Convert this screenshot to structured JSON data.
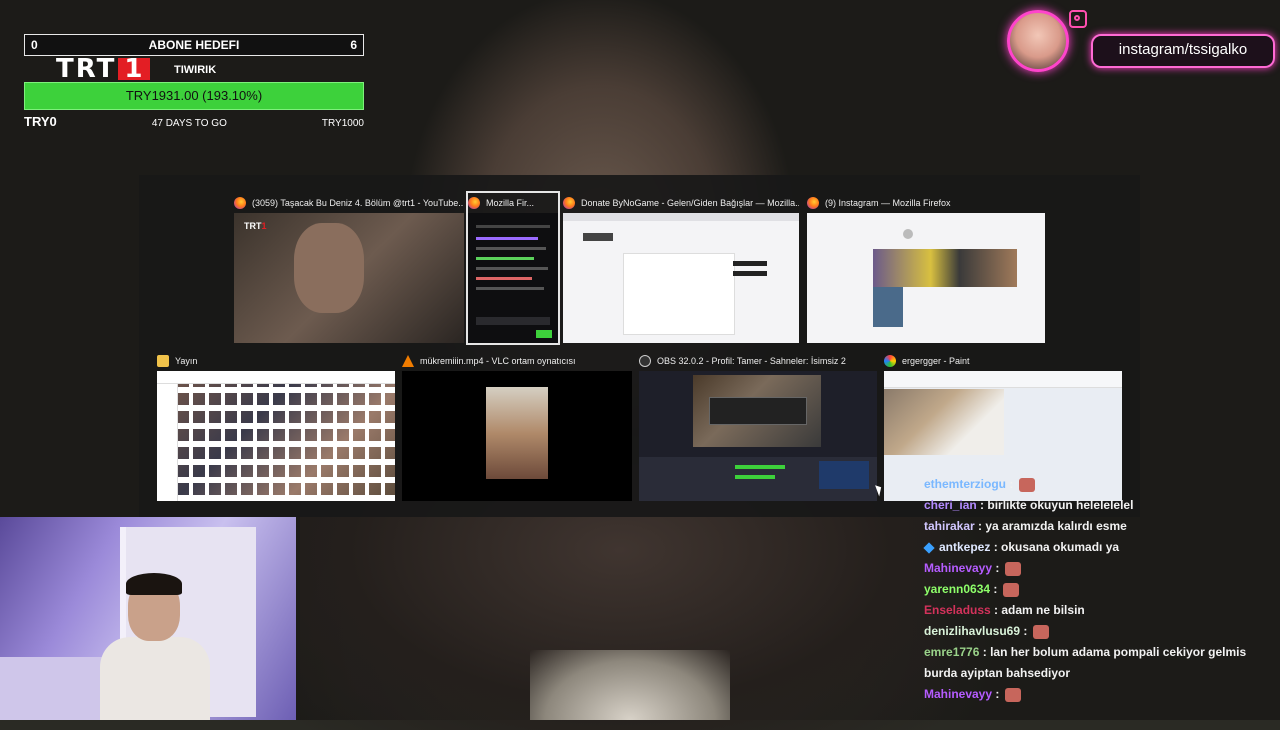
{
  "goal": {
    "start_count": "0",
    "title": "ABONE HEDEFI",
    "current_count": "6",
    "channel_tag": "TIWIRIK",
    "logo_text": "TRT",
    "logo_number": "1",
    "progress_text": "TRY1931.00 (193.10%)",
    "progress_percent": 193.1,
    "min_label": "TRY0",
    "days_label": "47 DAYS TO GO",
    "max_label": "TRY1000"
  },
  "instagram": {
    "handle": "instagram/tssigalko"
  },
  "switcher": {
    "windows": [
      {
        "title": "(3059) Taşacak Bu Deniz 4. Bölüm @trt1 - YouTube...",
        "icon": "firefox-icon",
        "thumb": "video"
      },
      {
        "title": "Mozilla Fir...",
        "icon": "firefox-icon",
        "thumb": "chat",
        "selected": true
      },
      {
        "title": "Donate ByNoGame - Gelen/Giden Bağışlar — Mozilla...",
        "icon": "firefox-icon",
        "thumb": "web"
      },
      {
        "title": "(9) Instagram — Mozilla Firefox",
        "icon": "firefox-icon",
        "thumb": "instagram"
      },
      {
        "title": "Yayın",
        "icon": "folder-icon",
        "thumb": "files"
      },
      {
        "title": "mükremiiin.mp4 - VLC ortam oynatıcısı",
        "icon": "vlc-icon",
        "thumb": "vlc"
      },
      {
        "title": "OBS 32.0.2 - Profil: Tamer - Sahneler: İsimsiz 2",
        "icon": "obs-icon",
        "thumb": "obs"
      },
      {
        "title": "ergergger - Paint",
        "icon": "paint-icon",
        "thumb": "paint"
      }
    ]
  },
  "chat": {
    "messages": [
      {
        "user": "ethemterziogu",
        "color": "#7ab8ff",
        "text": "",
        "emote": true
      },
      {
        "user": "cheri_ian",
        "color": "#b38bff",
        "text": "birlikte okuyun helelelelel"
      },
      {
        "user": "tahirakar",
        "color": "#d2c7ff",
        "text": "ya aramızda kalırdı esme"
      },
      {
        "user": "antkepez",
        "color": "#dfe8ff",
        "text": "okusana okumadı ya",
        "badge": true
      },
      {
        "user": "Mahinevayy",
        "color": "#b55cff",
        "text": "",
        "emote": true
      },
      {
        "user": "yarenn0634",
        "color": "#8eff6a",
        "text": "",
        "emote": true
      },
      {
        "user": "Enseladuss",
        "color": "#d3325b",
        "text": "adam ne bilsin"
      },
      {
        "user": "denizlihavlusu69",
        "color": "#d9f2d9",
        "text": "",
        "emote": true
      },
      {
        "user": "emre1776",
        "color": "#9ad38a",
        "text": "lan her bolum adama pompali cekiyor gelmis burda ayiptan bahsediyor"
      },
      {
        "user": "Mahinevayy",
        "color": "#b55cff",
        "text": "",
        "emote": true
      }
    ]
  }
}
